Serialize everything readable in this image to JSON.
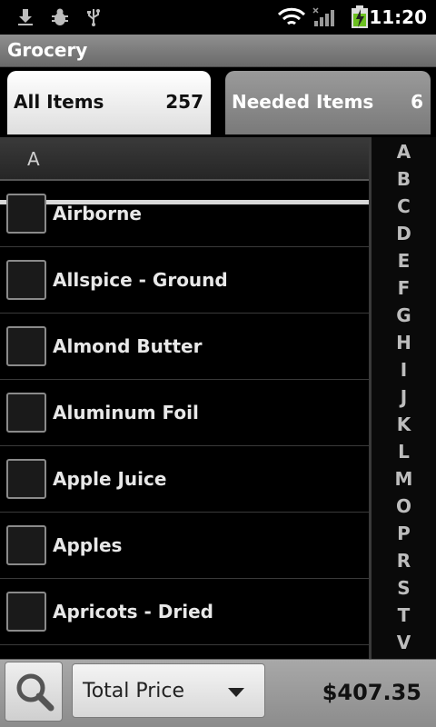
{
  "status_bar": {
    "time": "11:20",
    "icons": [
      "download-icon",
      "bug-icon",
      "usb-icon",
      "wifi-icon",
      "signal-icon",
      "battery-charging-icon"
    ]
  },
  "app": {
    "title": "Grocery"
  },
  "tabs": [
    {
      "label": "All Items",
      "count": "257",
      "selected": true
    },
    {
      "label": "Needed Items",
      "count": "6",
      "selected": false
    }
  ],
  "list": {
    "section_header": "A",
    "items": [
      {
        "name": "Airborne",
        "checked": false
      },
      {
        "name": "Allspice - Ground",
        "checked": false
      },
      {
        "name": "Almond Butter",
        "checked": false
      },
      {
        "name": "Aluminum Foil",
        "checked": false
      },
      {
        "name": "Apple Juice",
        "checked": false
      },
      {
        "name": "Apples",
        "checked": false
      },
      {
        "name": "Apricots - Dried",
        "checked": false
      }
    ]
  },
  "index": [
    "A",
    "B",
    "C",
    "D",
    "E",
    "F",
    "G",
    "H",
    "I",
    "J",
    "K",
    "L",
    "M",
    "O",
    "P",
    "R",
    "S",
    "T",
    "V"
  ],
  "bottom_bar": {
    "search_icon": "search-icon",
    "dropdown_selected": "Total Price",
    "total": "$407.35"
  },
  "colors": {
    "selected_tab": "#ffffff",
    "unselected_tab": "#8a8a8a",
    "background": "#000000"
  }
}
